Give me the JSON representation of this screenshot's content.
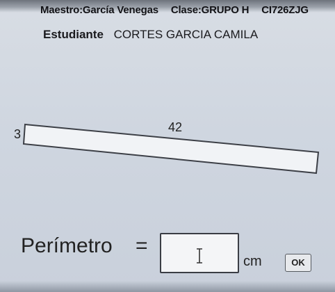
{
  "header": {
    "teacher": "Maestro:García Venegas",
    "class": "Clase:GRUPO H",
    "code": "CI726ZJG"
  },
  "student": {
    "label": "Estudiante",
    "name": "CORTES GARCIA CAMILA"
  },
  "figure": {
    "width_label": "42",
    "height_label": "3"
  },
  "question": {
    "label": "Perímetro",
    "equals": "=",
    "answer_value": "",
    "unit": "cm",
    "ok_label": "OK"
  }
}
